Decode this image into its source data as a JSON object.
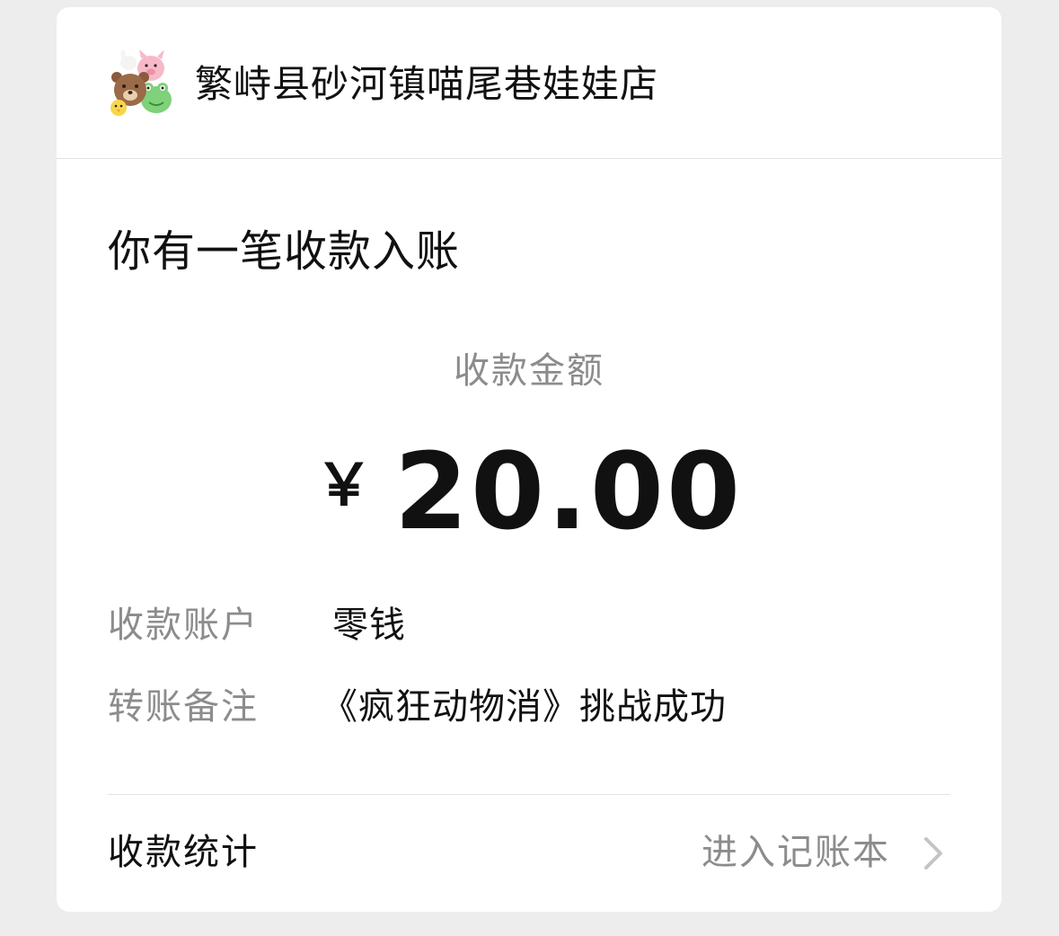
{
  "header": {
    "merchant_name": "繁峙县砂河镇喵尾巷娃娃店",
    "avatar_icon": "plush-toys-avatar-icon"
  },
  "notice": {
    "title": "你有一笔收款入账"
  },
  "amount": {
    "label": "收款金额",
    "currency": "￥",
    "value": "20.00"
  },
  "details": [
    {
      "label": "收款账户",
      "value": "零钱"
    },
    {
      "label": "转账备注",
      "value": "《疯狂动物消》挑战成功"
    }
  ],
  "footer": {
    "left_label": "收款统计",
    "right_link": "进入记账本",
    "chevron_icon": "chevron-right-icon"
  },
  "colors": {
    "page_background": "#ededed",
    "card_background": "#ffffff",
    "primary_text": "#111111",
    "secondary_text": "#8c8c8c",
    "divider": "#e2e2e2"
  }
}
